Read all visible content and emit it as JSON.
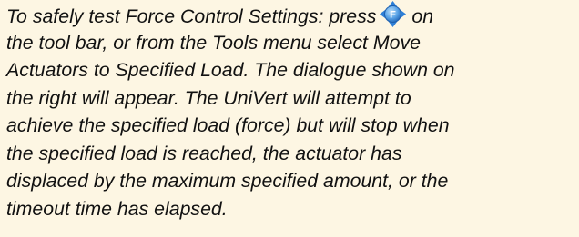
{
  "instruction": {
    "line1_before_icon": "To safely test Force Control Settings:  press",
    "icon": "force-move-toolbar-icon",
    "icon_letter": "F",
    "line1_after_icon": "on",
    "lines": [
      "the tool bar, or from the Tools menu select Move",
      "Actuators to Specified Load.  The dialogue shown on",
      "the right will appear.  The UniVert will attempt to",
      "achieve the specified load (force) but will stop when",
      "the specified load is reached, the actuator has",
      "displaced by the maximum specified amount, or the",
      "timeout time has elapsed."
    ]
  },
  "colors": {
    "background": "#FDF6E3",
    "text": "#111111",
    "icon_blue": "#2E7FD6",
    "icon_blue_light": "#8CC3F2"
  }
}
